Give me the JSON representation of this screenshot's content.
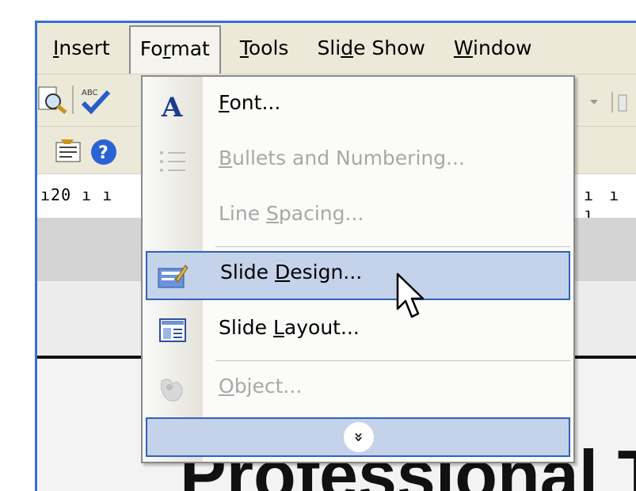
{
  "menubar": {
    "items": [
      {
        "pre": "",
        "u": "I",
        "post": "nsert"
      },
      {
        "pre": "Fo",
        "u": "r",
        "post": "mat"
      },
      {
        "pre": "",
        "u": "T",
        "post": "ools"
      },
      {
        "pre": "Sli",
        "u": "d",
        "post": "e Show"
      },
      {
        "pre": "",
        "u": "W",
        "post": "indow"
      }
    ]
  },
  "ruler": {
    "left": "ı20 ı ı",
    "right": "ı ı ı"
  },
  "format_menu": {
    "items": [
      {
        "pre": "",
        "u": "F",
        "post": "ont...",
        "icon": "font-A-icon",
        "enabled": true
      },
      {
        "pre": "",
        "u": "B",
        "post": "ullets and Numbering...",
        "icon": "bullets-icon",
        "enabled": false
      },
      {
        "pre": "Line ",
        "u": "S",
        "post": "pacing...",
        "icon": "",
        "enabled": false
      },
      {
        "pre": "Slide ",
        "u": "D",
        "post": "esign...",
        "icon": "slide-design-icon",
        "enabled": true
      },
      {
        "pre": "Slide ",
        "u": "L",
        "post": "ayout...",
        "icon": "slide-layout-icon",
        "enabled": true
      },
      {
        "pre": "",
        "u": "O",
        "post": "bject...",
        "icon": "object-icon",
        "enabled": false
      }
    ],
    "expand_glyph": "»"
  },
  "slide": {
    "title": "Professional To"
  },
  "colors": {
    "highlight_fill": "#c4d3ea",
    "highlight_border": "#3162b8",
    "titlebar_blue": "#3b6fd0"
  }
}
